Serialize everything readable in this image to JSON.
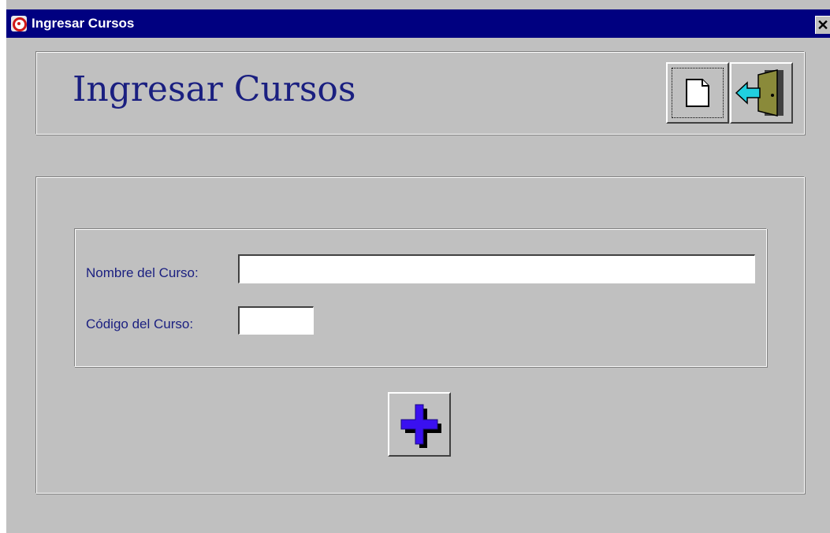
{
  "window": {
    "title": "Ingresar Cursos",
    "close_label": "✕"
  },
  "header": {
    "title": "Ingresar Cursos"
  },
  "toolbar": {
    "new_icon": "new-document-icon",
    "exit_icon": "exit-door-icon"
  },
  "form": {
    "course_name_label": "Nombre del Curso:",
    "course_name_value": "",
    "course_code_label": "Código del Curso:",
    "course_code_value": "",
    "add_icon": "plus-icon"
  },
  "colors": {
    "titlebar": "#000080",
    "label_text": "#1a1f80",
    "plus_fill": "#3a10f0",
    "door": "#8a8a3a",
    "arrow": "#20d0e0"
  }
}
